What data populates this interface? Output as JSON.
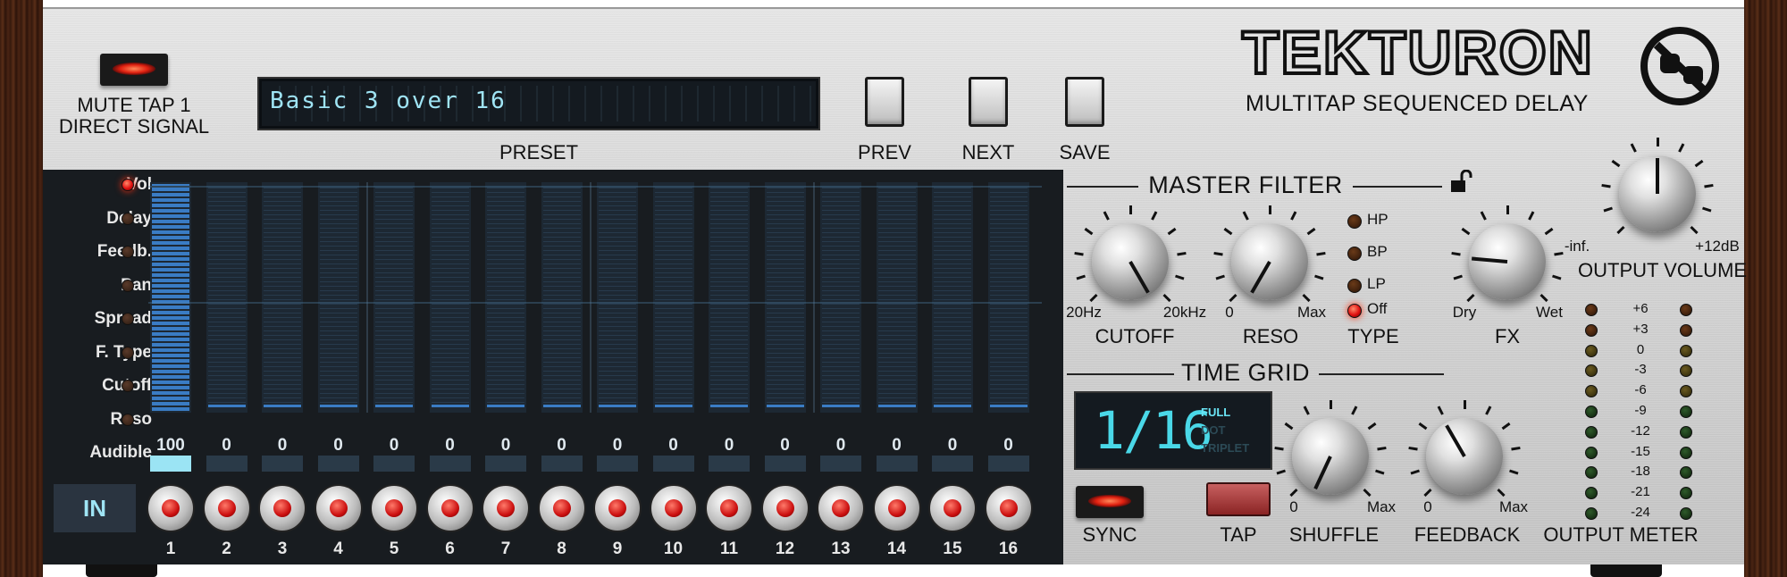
{
  "brand": {
    "name": "TEKTURON",
    "subtitle": "MULTITAP SEQUENCED DELAY"
  },
  "mute": {
    "label_line1": "MUTE TAP 1",
    "label_line2": "DIRECT SIGNAL"
  },
  "preset": {
    "name": "Basic 3 over 16",
    "label": "PRESET"
  },
  "buttons": {
    "prev": "PREV",
    "next": "NEXT",
    "save": "SAVE"
  },
  "sequencer": {
    "param_labels": [
      "Vol",
      "Delay",
      "Feedb.",
      "Pan",
      "Spread",
      "F. Type",
      "Cutoff",
      "Reso",
      "Audible"
    ],
    "active_param": 0,
    "values": [
      "100",
      "0",
      "0",
      "0",
      "0",
      "0",
      "0",
      "0",
      "0",
      "0",
      "0",
      "0",
      "0",
      "0",
      "0",
      "0"
    ],
    "levels": [
      1,
      0,
      0,
      0,
      0,
      0,
      0,
      0,
      0,
      0,
      0,
      0,
      0,
      0,
      0,
      0
    ],
    "audible": [
      true,
      false,
      false,
      false,
      false,
      false,
      false,
      false,
      false,
      false,
      false,
      false,
      false,
      false,
      false,
      false
    ],
    "step_numbers": [
      "1",
      "2",
      "3",
      "4",
      "5",
      "6",
      "7",
      "8",
      "9",
      "10",
      "11",
      "12",
      "13",
      "14",
      "15",
      "16"
    ],
    "in_label": "IN"
  },
  "master_filter": {
    "title": "MASTER FILTER",
    "cutoff": {
      "label": "CUTOFF",
      "min": "20Hz",
      "max": "20kHz"
    },
    "reso": {
      "label": "RESO",
      "min": "0",
      "max": "Max"
    },
    "type": {
      "label": "TYPE",
      "options": [
        "HP",
        "BP",
        "LP",
        "Off"
      ],
      "selected": "Off"
    }
  },
  "fx": {
    "label": "FX",
    "min": "Dry",
    "max": "Wet"
  },
  "output_volume": {
    "label": "OUTPUT VOLUME",
    "min": "-inf.",
    "max": "+12dB"
  },
  "time_grid": {
    "title": "TIME GRID",
    "value": "1/16",
    "modes": [
      "FULL",
      "DOT",
      "TRIPLET"
    ],
    "selected_mode": "FULL"
  },
  "sync": {
    "label": "SYNC"
  },
  "tap": {
    "label": "TAP"
  },
  "shuffle": {
    "label": "SHUFFLE",
    "min": "0",
    "max": "Max"
  },
  "feedback": {
    "label": "FEEDBACK",
    "min": "0",
    "max": "Max"
  },
  "output_meter": {
    "label": "OUTPUT METER",
    "scale": [
      "+6",
      "+3",
      "0",
      "-3",
      "-6",
      "-9",
      "-12",
      "-15",
      "-18",
      "-21",
      "-24"
    ]
  }
}
